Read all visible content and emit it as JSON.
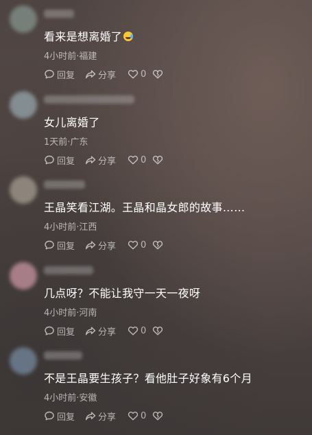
{
  "labels": {
    "reply": "回复",
    "share": "分享"
  },
  "comments": [
    {
      "text": "看来是想离婚了",
      "emoji": "laugh-cry-emoji",
      "time": "4小时前",
      "location": "福建",
      "likes": "0",
      "avatar_color": "#7d8a83"
    },
    {
      "text": "女儿离婚了",
      "time": "1天前",
      "location": "广东",
      "likes": "0",
      "avatar_color": "#8d9aa0"
    },
    {
      "text": "王晶笑看江湖。王晶和晶女郎的故事……",
      "time": "4小时前",
      "location": "江西",
      "likes": "0",
      "avatar_color": "#9a9186"
    },
    {
      "text": "几点呀？不能让我守一天一夜呀",
      "time": "4小时前",
      "location": "河南",
      "likes": "0",
      "avatar_color": "#b98a95"
    },
    {
      "text": "不是王晶要生孩子？看他肚子好象有6个月",
      "time": "4小时前",
      "location": "安徽",
      "likes": "0",
      "avatar_color": "#6f7f93"
    }
  ]
}
